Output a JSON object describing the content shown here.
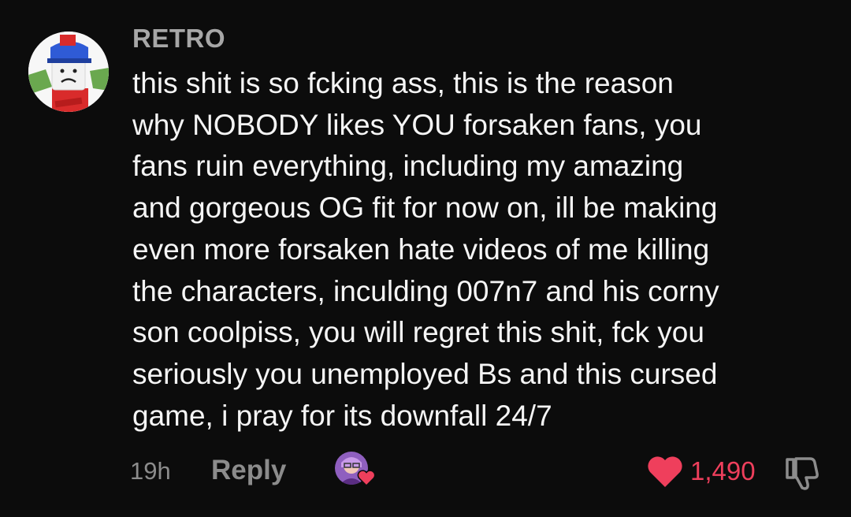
{
  "comment": {
    "username": "RETRO",
    "text_lines": [
      "this shit is so fcking ass, this is the reason",
      "why NOBODY likes YOU forsaken fans, you",
      "fans ruin everything, including my amazing",
      "and gorgeous OG fit for now on, ill be making",
      "even more forsaken hate videos of me killing",
      "the characters, inculding 007n7 and his corny",
      "son coolpiss, you will regret this shit, fck you",
      "seriously you unemployed Bs and this cursed",
      "game, i pray for its downfall 24/7"
    ],
    "timestamp": "19h",
    "reply_label": "Reply",
    "like_count": "1,490",
    "liked": true
  },
  "icons": {
    "like": "heart-icon",
    "dislike": "thumbs-down-icon",
    "creator_badge": "creator-heart-icon"
  },
  "colors": {
    "background": "#0c0c0c",
    "text": "#f5f5f5",
    "muted": "#8c8c8c",
    "username": "#a7a7a7",
    "like": "#ef3f5c"
  }
}
